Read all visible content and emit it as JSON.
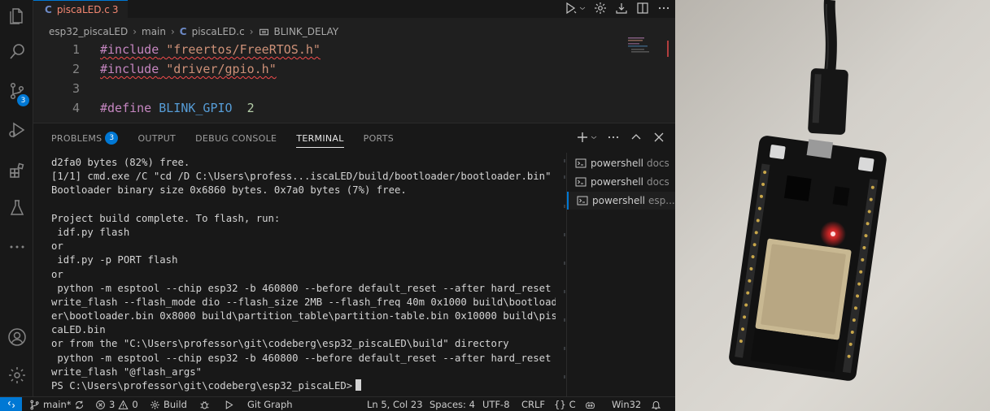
{
  "tab": {
    "icon": "C",
    "name": "piscaLED.c",
    "problems": "3"
  },
  "breadcrumb": {
    "folder": "esp32_piscaLED",
    "sub": "main",
    "file_icon": "C",
    "file": "piscaLED.c",
    "symbol": "BLINK_DELAY"
  },
  "editor": {
    "lines": [
      {
        "n": "1",
        "kw": "#include",
        "rest": " \"freertos/FreeRTOS.h\""
      },
      {
        "n": "2",
        "kw": "#include",
        "rest": " \"driver/gpio.h\""
      },
      {
        "n": "3"
      },
      {
        "n": "4",
        "kw": "#define",
        "macro": " BLINK_GPIO",
        "num": "  2"
      }
    ]
  },
  "activity": {
    "scm_badge": "3"
  },
  "panel": {
    "tabs": [
      "PROBLEMS",
      "OUTPUT",
      "DEBUG CONSOLE",
      "TERMINAL",
      "PORTS"
    ],
    "problems_badge": "3"
  },
  "terminal": {
    "lines": [
      "d2fa0 bytes (82%) free.",
      "[1/1] cmd.exe /C \"cd /D C:\\Users\\profess...iscaLED/build/bootloader/bootloader.bin\"",
      "Bootloader binary size 0x6860 bytes. 0x7a0 bytes (7%) free.",
      "",
      "Project build complete. To flash, run:",
      " idf.py flash",
      "or",
      " idf.py -p PORT flash",
      "or",
      " python -m esptool --chip esp32 -b 460800 --before default_reset --after hard_reset",
      "write_flash --flash_mode dio --flash_size 2MB --flash_freq 40m 0x1000 build\\bootload",
      "er\\bootloader.bin 0x8000 build\\partition_table\\partition-table.bin 0x10000 build\\pis",
      "caLED.bin",
      "or from the \"C:\\Users\\professor\\git\\codeberg\\esp32_piscaLED\\build\" directory",
      " python -m esptool --chip esp32 -b 460800 --before default_reset --after hard_reset",
      "write_flash \"@flash_args\""
    ],
    "prompt": "PS C:\\Users\\professor\\git\\codeberg\\esp32_piscaLED>",
    "sessions": [
      {
        "name": "powershell",
        "dir": "docs"
      },
      {
        "name": "powershell",
        "dir": "docs"
      },
      {
        "name": "powershell",
        "dir": "esp..."
      }
    ]
  },
  "status": {
    "branch": "main*",
    "errors": "3",
    "warnings": "0",
    "build": "Build",
    "git_graph": "Git Graph",
    "position": "Ln 5, Col 23",
    "spaces": "Spaces: 4",
    "encoding": "UTF-8",
    "eol": "CRLF",
    "language": "C",
    "platform": "Win32"
  },
  "colors": {
    "accent": "#0078d4",
    "error": "#f48771",
    "led": "#ff2a2a"
  }
}
